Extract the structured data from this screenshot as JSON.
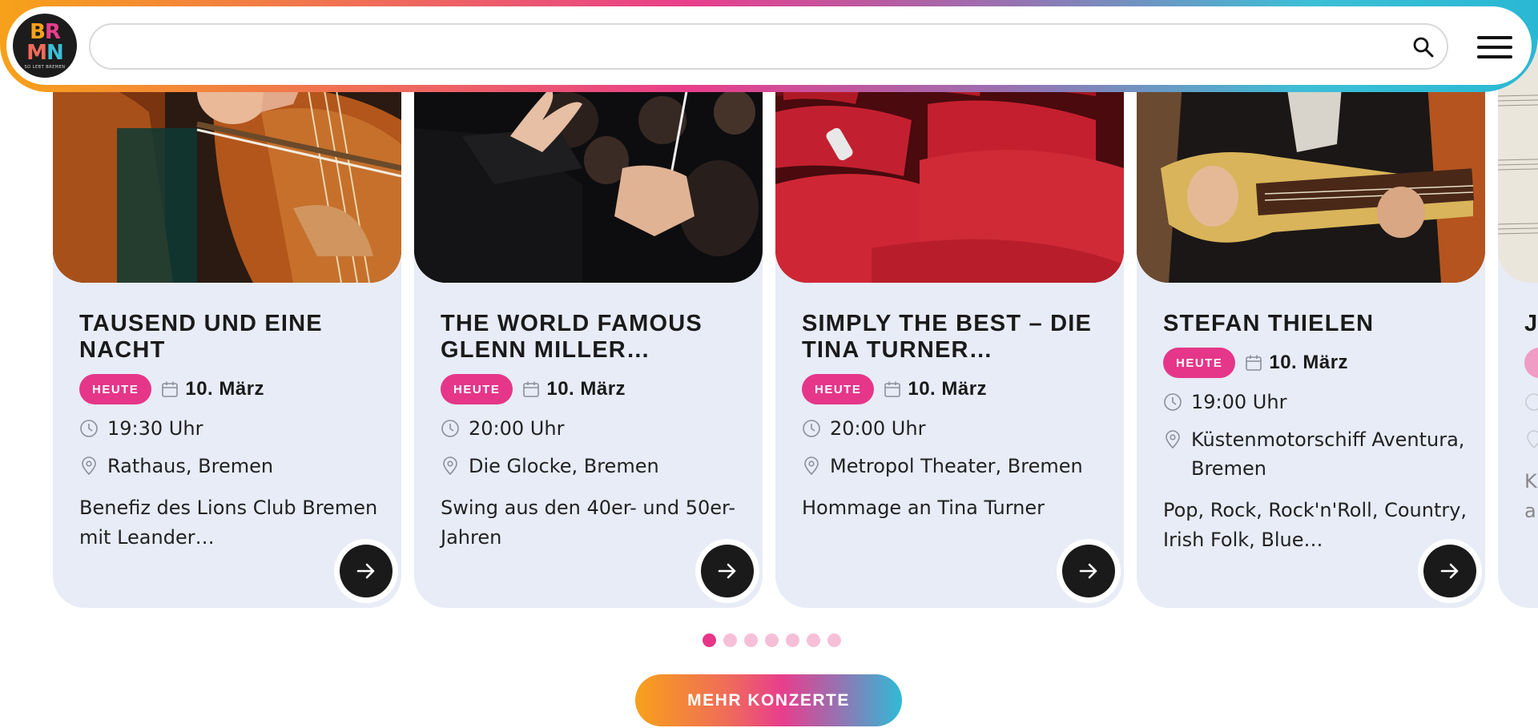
{
  "header": {
    "logo_text_top": "BR",
    "logo_text_bottom": "MN",
    "logo_tagline": "SO LEBT BREMEN",
    "search_value": "",
    "search_icon": "search-icon",
    "menu_icon": "hamburger-menu-icon"
  },
  "cards": [
    {
      "title": "TAUSEND UND EINE NACHT",
      "badge": "HEUTE",
      "date": "10. März",
      "time": "19:30 Uhr",
      "location": "Rathaus, Bremen",
      "description": "Benefiz des Lions Club Bremen mit Leander…",
      "image": "cello-player-photo"
    },
    {
      "title": "THE WORLD FAMOUS GLENN MILLER…",
      "badge": "HEUTE",
      "date": "10. März",
      "time": "20:00 Uhr",
      "location": "Die Glocke, Bremen",
      "description": "Swing aus den 40er- und 50er-Jahren",
      "image": "conductor-photo"
    },
    {
      "title": "SIMPLY THE BEST – DIE TINA TURNER…",
      "badge": "HEUTE",
      "date": "10. März",
      "time": "20:00 Uhr",
      "location": "Metropol Theater, Bremen",
      "description": "Hommage an Tina Turner",
      "image": "theater-seats-photo"
    },
    {
      "title": "STEFAN THIELEN",
      "badge": "HEUTE",
      "date": "10. März",
      "time": "19:00 Uhr",
      "location": "Küstenmotorschiff Aventura, Bremen",
      "description": "Pop, Rock, Rock'n'Roll, Country, Irish Folk, Blue…",
      "image": "guitar-player-photo"
    }
  ],
  "partial_card": {
    "title_fragment": "JU",
    "desc_fragment_1": "K",
    "desc_fragment_2": "a"
  },
  "pagination": {
    "total": 7,
    "active": 1
  },
  "cta_label": "MEHR KONZERTE",
  "colors": {
    "accent_pink": "#e5368a",
    "card_bg": "#e7ecf6",
    "gradient_orange": "#f7a11a",
    "gradient_cyan": "#3cbfd6"
  }
}
